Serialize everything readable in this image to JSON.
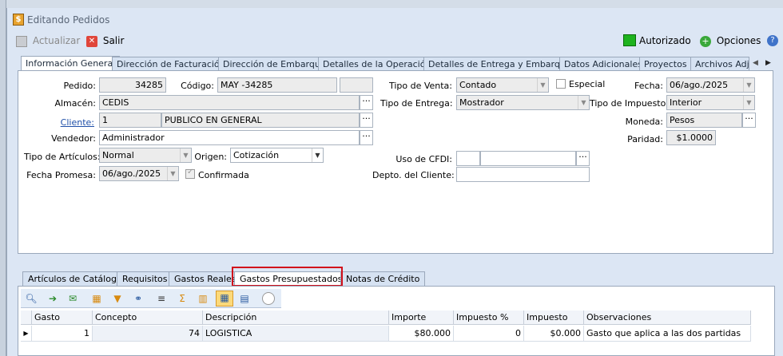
{
  "window": {
    "title": "Editando Pedidos"
  },
  "toolbar": {
    "actualizar": "Actualizar",
    "salir": "Salir",
    "status": "Autorizado",
    "status_color": "#1eb31e",
    "opciones": "Opciones"
  },
  "tabs": [
    "Información General",
    "Dirección de Facturación",
    "Dirección de Embarque",
    "Detalles de la Operación",
    "Detalles de Entrega y Embarque",
    "Datos Adicionales",
    "Proyectos",
    "Archivos Adju"
  ],
  "form": {
    "pedido_label": "Pedido:",
    "pedido": "34285",
    "codigo_label": "Código:",
    "codigo": "MAY  -34285",
    "almacen_label": "Almacén:",
    "almacen": "CEDIS",
    "cliente_label": "Cliente:",
    "cliente_id": "1",
    "cliente_nombre": "PUBLICO EN GENERAL",
    "vendedor_label": "Vendedor:",
    "vendedor": "Administrador",
    "tipo_articulos_label": "Tipo de Artículos:",
    "tipo_articulos": "Normal",
    "origen_label": "Origen:",
    "origen": "Cotización",
    "fecha_promesa_label": "Fecha Promesa:",
    "fecha_promesa": "06/ago./2025",
    "confirmada_label": "Confirmada",
    "tipo_venta_label": "Tipo de Venta:",
    "tipo_venta": "Contado",
    "especial_label": "Especial",
    "tipo_entrega_label": "Tipo de Entrega:",
    "tipo_entrega": "Mostrador",
    "uso_cfdi_label": "Uso de CFDI:",
    "depto_label": "Depto. del Cliente:",
    "fecha_label": "Fecha:",
    "fecha": "06/ago./2025",
    "tipo_impuesto_label": "Tipo de Impuesto:",
    "tipo_impuesto": "Interior",
    "moneda_label": "Moneda:",
    "moneda": "Pesos",
    "paridad_label": "Paridad:",
    "paridad": "$1.0000"
  },
  "bottom_tabs": [
    "Artículos de Catálogo",
    "Requisitos",
    "Gastos Reales",
    "Gastos Presupuestados",
    "Notas de Crédito"
  ],
  "grid": {
    "columns": [
      "Gasto",
      "Concepto",
      "Descripción",
      "Importe",
      "Impuesto %",
      "Impuesto",
      "Observaciones"
    ],
    "rows": [
      {
        "gasto": "1",
        "concepto": "74",
        "descripcion": "LOGISTICA",
        "importe": "$80.000",
        "impuesto_pct": "0",
        "impuesto": "$0.000",
        "observaciones": "Gasto que aplica a las dos partidas"
      }
    ]
  }
}
